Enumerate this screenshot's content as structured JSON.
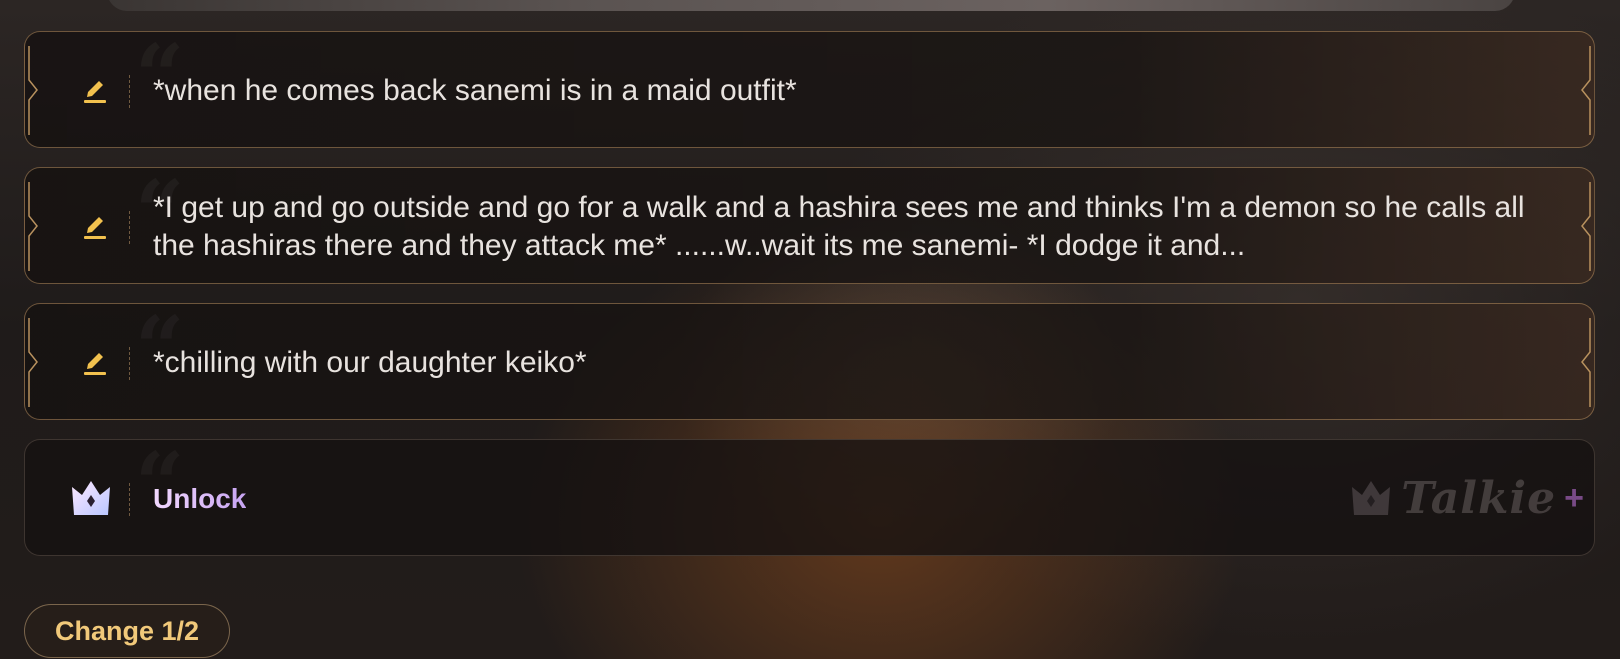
{
  "suggestions": [
    {
      "text": "*when he comes back sanemi is in a maid outfit*"
    },
    {
      "text": "*I get up and go outside and go for a walk and a hashira sees me and thinks I'm a demon so he calls all the hashiras there and they attack me* ......w..wait its me sanemi- *I dodge it and..."
    },
    {
      "text": "*chilling with our daughter keiko*"
    }
  ],
  "unlock": {
    "label": "Unlock",
    "brand_name": "Talkie",
    "brand_plus": "+"
  },
  "change_button": {
    "label": "Change 1/2"
  },
  "icons": {
    "edit": "pencil-icon",
    "premium": "crown-icon"
  },
  "colors": {
    "accent_gold": "#f1c97a",
    "pencil": "#f2c14e",
    "unlock_gradient": "#e9c6ff"
  }
}
